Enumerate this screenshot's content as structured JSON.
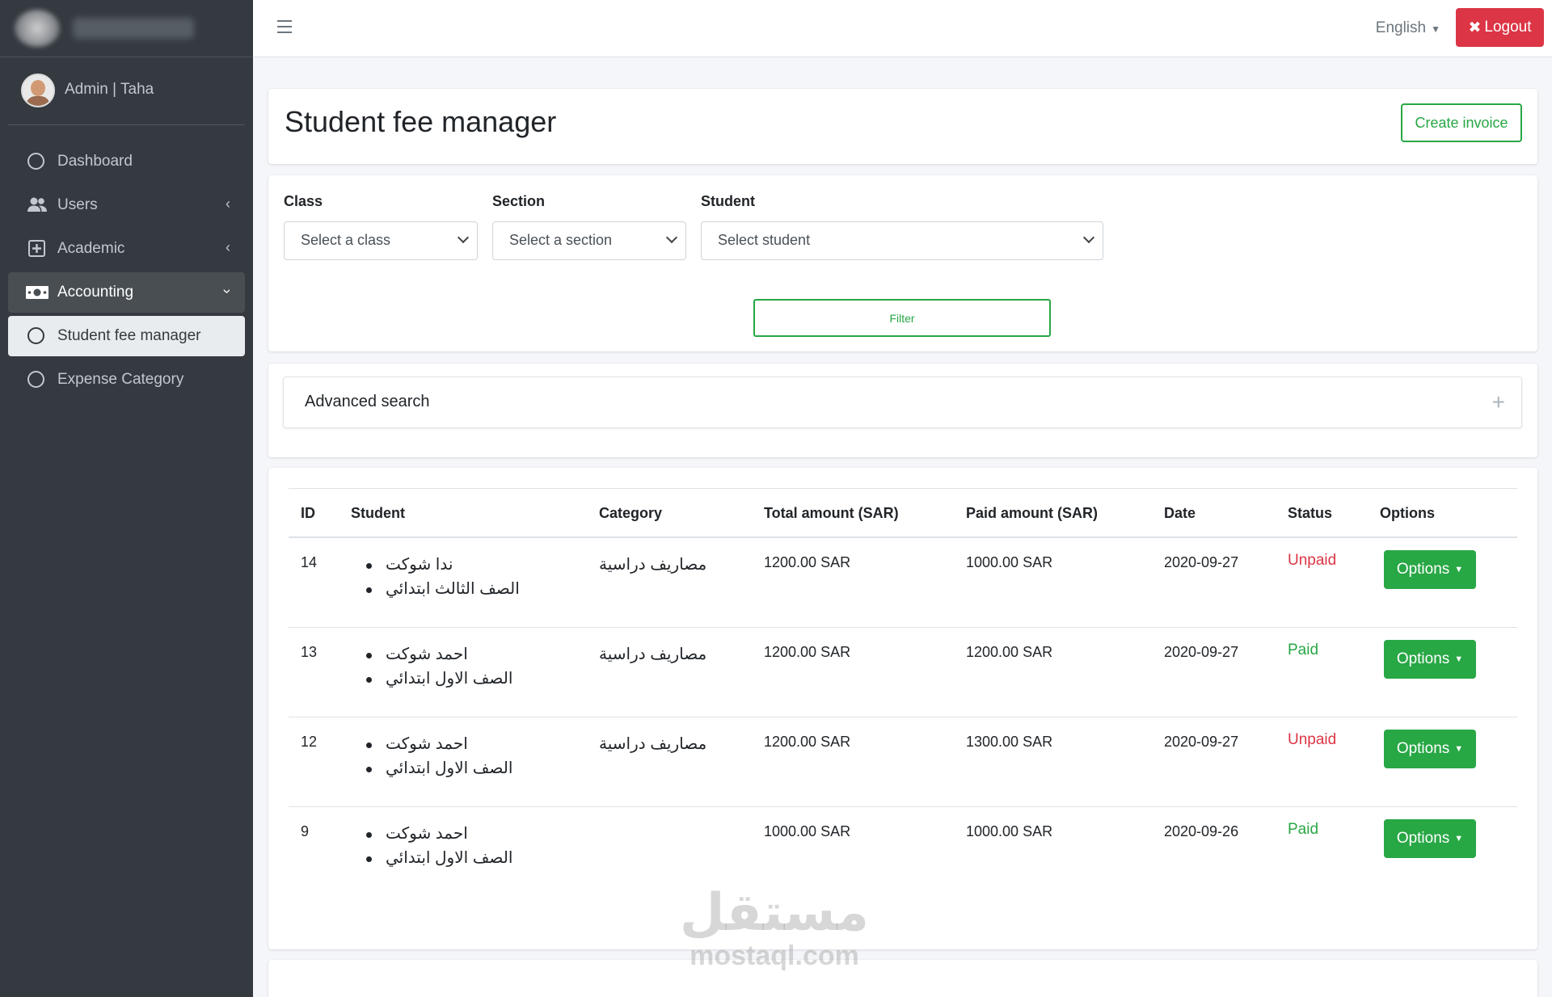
{
  "sidebar": {
    "user_name": "Admin | Taha",
    "items": [
      {
        "label": "Dashboard"
      },
      {
        "label": "Users"
      },
      {
        "label": "Academic"
      },
      {
        "label": "Accounting"
      },
      {
        "label": "Student fee manager"
      },
      {
        "label": "Expense Category"
      }
    ]
  },
  "topbar": {
    "language": "English",
    "logout_label": "Logout"
  },
  "header": {
    "title": "Student fee manager",
    "create_invoice_label": "Create invoice"
  },
  "filters": {
    "class_label": "Class",
    "class_value": "Select a class",
    "section_label": "Section",
    "section_value": "Select a section",
    "student_label": "Student",
    "student_value": "Select student",
    "filter_label": "Filter"
  },
  "advanced_search": {
    "title": "Advanced search"
  },
  "table": {
    "headers": [
      "ID",
      "Student",
      "Category",
      "Total amount (SAR)",
      "Paid amount (SAR)",
      "Date",
      "Status",
      "Options"
    ],
    "rows": [
      {
        "id": "14",
        "student_name": "ندا شوكت",
        "student_class": "الصف الثالث ابتدائي",
        "category": "مصاريف دراسية",
        "total": "1200.00 SAR",
        "paid": "1000.00 SAR",
        "date": "2020-09-27",
        "status": "Unpaid",
        "options": "Options"
      },
      {
        "id": "13",
        "student_name": "احمد شوكت",
        "student_class": "الصف الاول ابتدائي",
        "category": "مصاريف دراسية",
        "total": "1200.00 SAR",
        "paid": "1200.00 SAR",
        "date": "2020-09-27",
        "status": "Paid",
        "options": "Options"
      },
      {
        "id": "12",
        "student_name": "احمد شوكت",
        "student_class": "الصف الاول ابتدائي",
        "category": "مصاريف دراسية",
        "total": "1200.00 SAR",
        "paid": "1300.00 SAR",
        "date": "2020-09-27",
        "status": "Unpaid",
        "options": "Options"
      },
      {
        "id": "9",
        "student_name": "احمد شوكت",
        "student_class": "الصف الاول ابتدائي",
        "category": "",
        "total": "1000.00 SAR",
        "paid": "1000.00 SAR",
        "date": "2020-09-26",
        "status": "Paid",
        "options": "Options"
      }
    ]
  },
  "watermark": {
    "arabic": "مستقل",
    "latin": "mostaql.com"
  },
  "colors": {
    "sidebar_bg": "#343a40",
    "accent_green": "#28a745",
    "danger_red": "#dc3545",
    "unpaid": "#dc3545",
    "paid": "#28a745"
  }
}
